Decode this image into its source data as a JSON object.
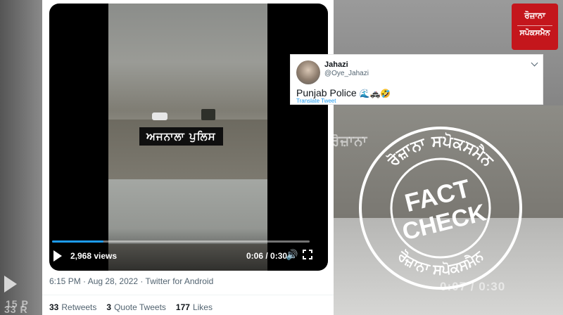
{
  "background": {
    "ghost_text": "ਰੋਜ਼ਾਨਾ",
    "ghost_timecode": "0:07 / 0:30",
    "ghost_left": "15 P",
    "ghost_left2": "33 R"
  },
  "tweet": {
    "video": {
      "overlay_label": "ਅਜਨਾਲਾ ਪੁਲਿਸ",
      "views": "2,968 views",
      "timecode": "0:06 / 0:30",
      "progress": 0.2,
      "accent": "#1d9bf0"
    },
    "meta": "6:15 PM · Aug 28, 2022 · Twitter for Android",
    "stats": [
      {
        "count": "33",
        "label": "Retweets"
      },
      {
        "count": "3",
        "label": "Quote Tweets"
      },
      {
        "count": "177",
        "label": "Likes"
      }
    ]
  },
  "quote": {
    "name": "Jahazi",
    "handle": "@Oye_Jahazi",
    "text": "Punjab Police",
    "emojis": "🌊🚓🤣",
    "translate": "Translate Tweet"
  },
  "logo": {
    "line1": "ਰੋਜ਼ਾਨਾ",
    "line2": "ਸਪੋਕਸਮੈਨ",
    "color": "#c4161c"
  },
  "stamp": {
    "center_line1": "FACT",
    "center_line2": "CHECK",
    "ring_top": "ਰੋਜ਼ਾਨਾ ਸਪੋਕਸਮੈਨ",
    "ring_bottom": "ਰੋਜ਼ਾਨਾ ਸਪੋਕਸਮੈਨ",
    "color": "#ffffff"
  }
}
